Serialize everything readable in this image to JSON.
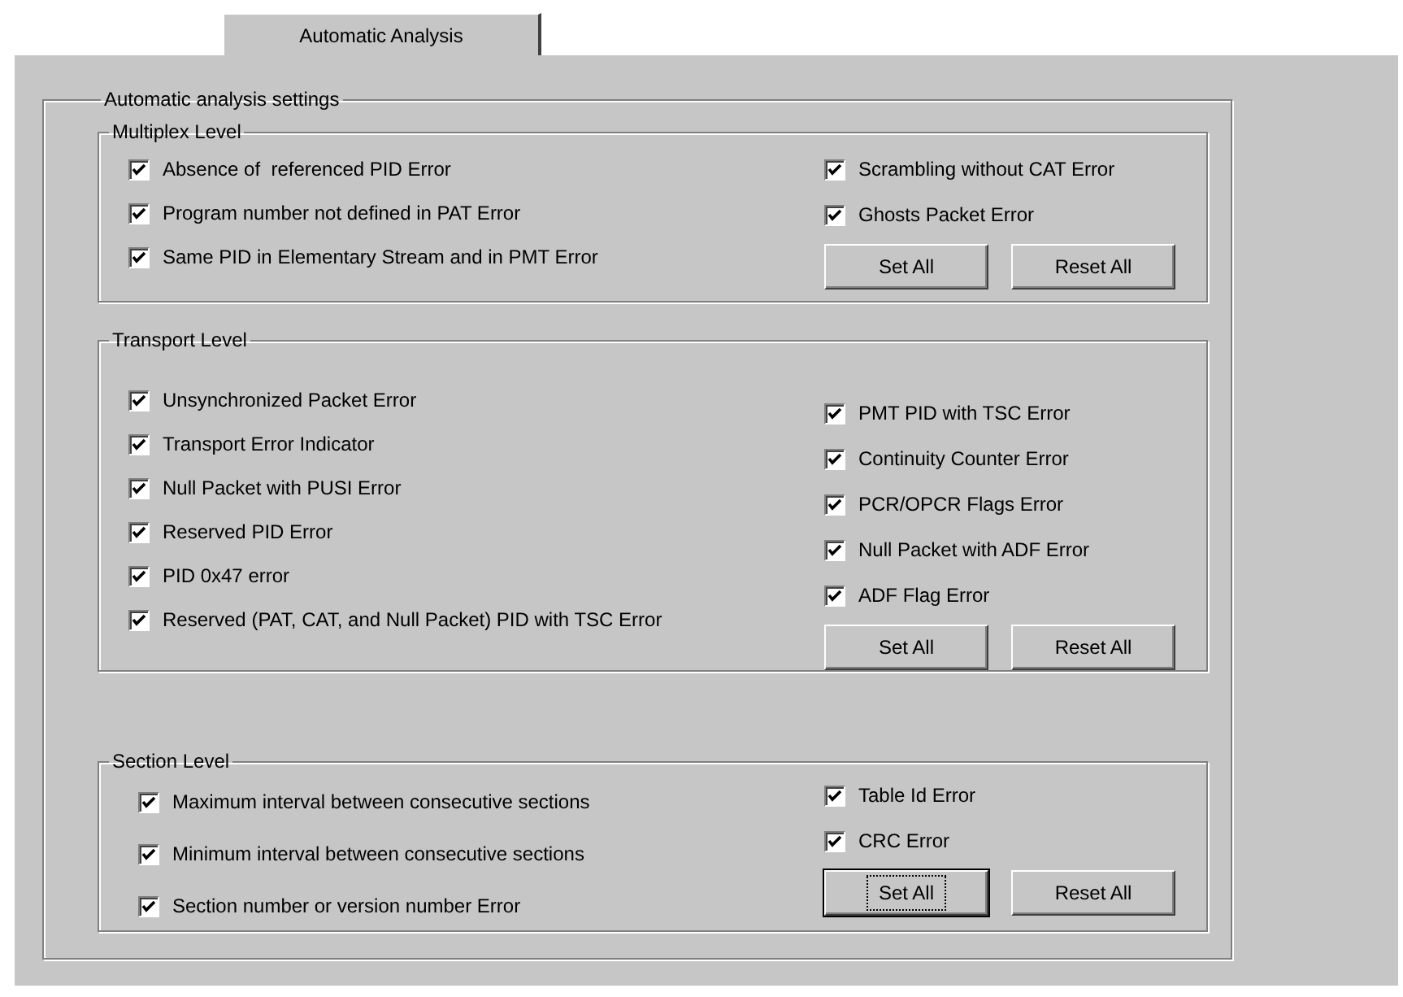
{
  "tabs": [
    {
      "label": "Automatic Analysis",
      "selected": true
    }
  ],
  "settings": {
    "title": "Automatic analysis settings",
    "groups": [
      {
        "title": "Multiplex Level",
        "kind": "compact",
        "left": [
          {
            "label": "Absence of  referenced PID Error",
            "checked": true
          },
          {
            "label": "Program number not defined in PAT Error",
            "checked": true
          },
          {
            "label": "Same PID in Elementary Stream and in PMT Error",
            "checked": true
          }
        ],
        "right": [
          {
            "label": "Scrambling without CAT Error",
            "checked": true
          },
          {
            "label": "Ghosts Packet Error",
            "checked": true
          }
        ],
        "buttons": [
          {
            "label": "Set All",
            "focused": false
          },
          {
            "label": "Reset All",
            "focused": false
          }
        ]
      },
      {
        "title": "Transport Level",
        "kind": "compact",
        "left": [
          {
            "label": "Unsynchronized Packet Error",
            "checked": true
          },
          {
            "label": "Transport Error Indicator",
            "checked": true
          },
          {
            "label": "Null Packet with PUSI Error",
            "checked": true
          },
          {
            "label": "Reserved PID Error",
            "checked": true
          },
          {
            "label": "PID 0x47 error",
            "checked": true
          },
          {
            "label": "Reserved (PAT, CAT, and Null Packet) PID with TSC Error",
            "checked": true
          }
        ],
        "right": [
          {
            "label": "PMT PID with TSC Error",
            "checked": true
          },
          {
            "label": "Continuity Counter Error",
            "checked": true
          },
          {
            "label": "PCR/OPCR Flags Error",
            "checked": true
          },
          {
            "label": "Null Packet with ADF Error",
            "checked": true
          },
          {
            "label": "ADF Flag Error",
            "checked": true
          }
        ],
        "buttons": [
          {
            "label": "Set All",
            "focused": false
          },
          {
            "label": "Reset All",
            "focused": false
          }
        ]
      },
      {
        "title": "Section Level",
        "kind": "spaced",
        "left": [
          {
            "label": "Maximum interval between consecutive sections",
            "checked": true
          },
          {
            "label": "Minimum interval between consecutive sections",
            "checked": true
          },
          {
            "label": "Section number or version number Error",
            "checked": true
          }
        ],
        "right": [
          {
            "label": "Table Id Error",
            "checked": true
          },
          {
            "label": "CRC Error",
            "checked": true
          }
        ],
        "buttons": [
          {
            "label": "Set All",
            "focused": true
          },
          {
            "label": "Reset All",
            "focused": false
          }
        ]
      }
    ]
  }
}
